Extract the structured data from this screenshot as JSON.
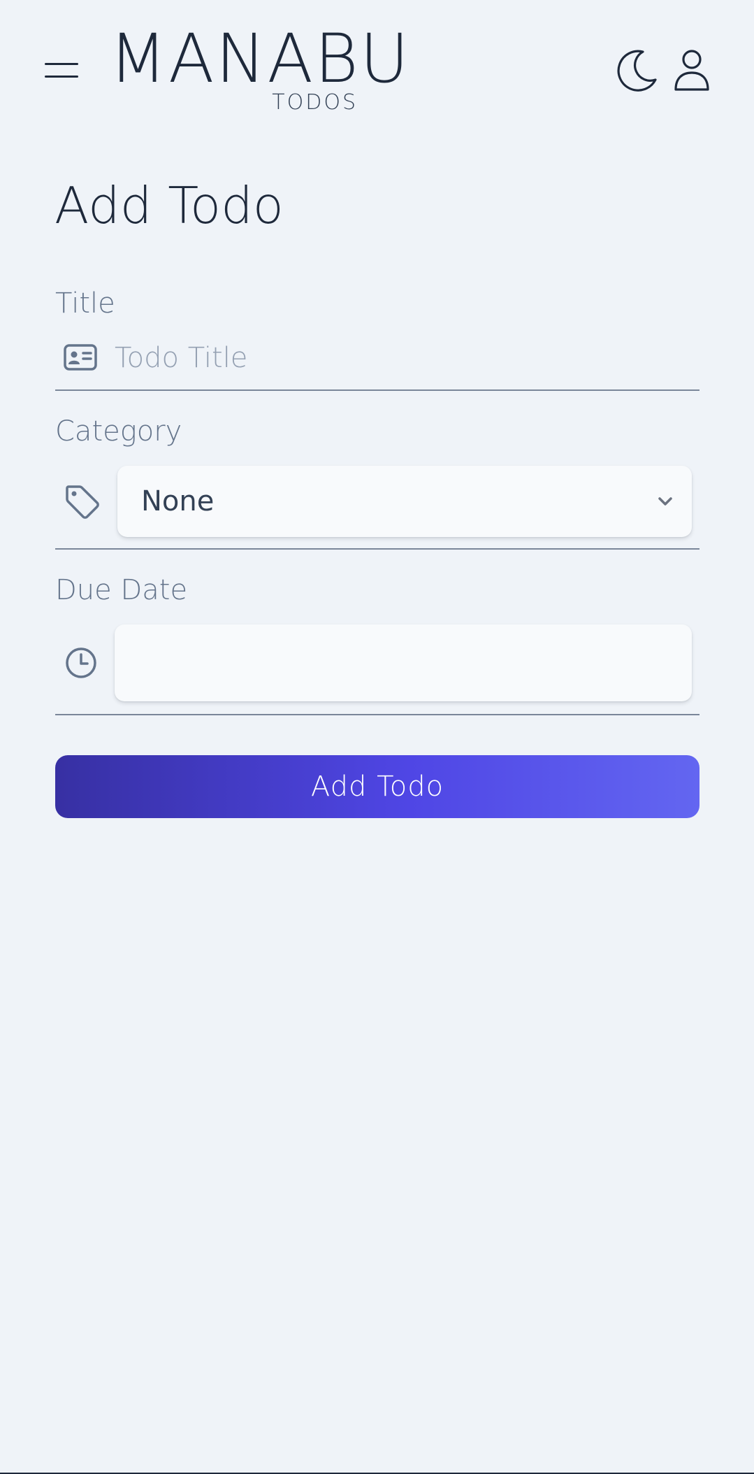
{
  "app": {
    "logo_word": "MANABU",
    "logo_sub": "TODOS"
  },
  "header": {
    "menu_icon": "hamburger-menu-icon",
    "theme_icon": "moon-icon",
    "profile_icon": "user-icon"
  },
  "page": {
    "title": "Add Todo"
  },
  "form": {
    "title_label": "Title",
    "title_placeholder": "Todo Title",
    "title_value": "",
    "title_icon": "id-card-icon",
    "category_label": "Category",
    "category_value": "None",
    "category_icon": "tag-icon",
    "due_date_label": "Due Date",
    "due_date_value": "",
    "due_date_icon": "clock-icon",
    "submit_label": "Add Todo"
  },
  "colors": {
    "background": "#eff3f8",
    "text": "#1e293b",
    "muted": "#64748b",
    "button_gradient_start": "#3730a3",
    "button_gradient_end": "#6366f1"
  }
}
